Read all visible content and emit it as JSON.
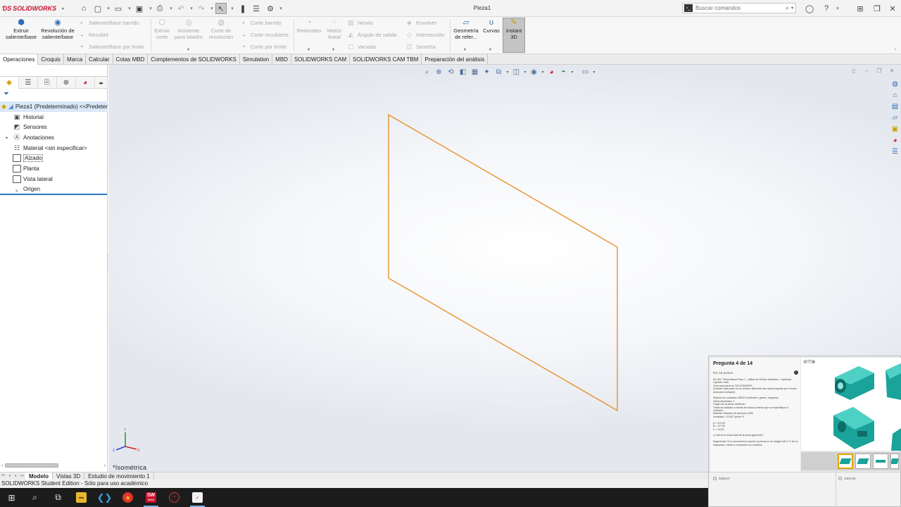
{
  "app": {
    "logo_text": "SOLIDWORKS",
    "document_title": "Pieza1"
  },
  "search": {
    "placeholder": "Buscar comandos"
  },
  "ribbon": {
    "extruir": "Extruir saliente/base",
    "revolucion": "Revolución de saliente/base",
    "barrido": "Saliente/Base barrido",
    "recubrir": "Recubrir",
    "por_limite": "Saliente/Base por límite",
    "extruir_corte": "Extruir corte",
    "asistente": "Asistente para taladro",
    "corte_revolucion": "Corte de revolución",
    "corte_barrido": "Corte barrido",
    "corte_recubierto": "Corte recubierto",
    "corte_limite": "Corte por límite",
    "redondeo": "Redondeo",
    "matriz_lineal": "Matriz lineal",
    "nervio": "Nervio",
    "angulo_salida": "Ángulo de salida",
    "vaciado": "Vaciado",
    "envolver": "Envolver",
    "interseccion": "Intersección",
    "simetria": "Simetría",
    "geometria": "Geometría de refer...",
    "curvas": "Curvas",
    "instant3d": "Instant 3D"
  },
  "tabs": [
    "Operaciones",
    "Croquis",
    "Marca",
    "Calcular",
    "Cotas MBD",
    "Complementos de SOLIDWORKS",
    "Simulation",
    "MBD",
    "SOLIDWORKS CAM",
    "SOLIDWORKS CAM TBM",
    "Preparación del análisis"
  ],
  "tree": {
    "root": "Pieza1 (Predeterminado) <<Predeterminado>",
    "items": [
      "Historial",
      "Sensores",
      "Anotaciones",
      "Material <sin especificar>",
      "Alzado",
      "Planta",
      "Vista lateral",
      "Origen"
    ]
  },
  "viewport": {
    "view_name": "*Isométrica",
    "sketch_color": "#e8922e",
    "triad_labels": {
      "x": "X",
      "y": "Y",
      "z": "Z"
    }
  },
  "bottom_tabs": [
    "Modelo",
    "Vistas 3D",
    "Estudio de movimiento 1"
  ],
  "status": {
    "text": "SOLIDWORKS Student Edition - Sólo para uso académico"
  },
  "quiz": {
    "title": "Pregunta 4 de 14",
    "points": "Por 15 puntos",
    "body": "ID+401: Pieza básica Paso 1 - (Mitad de cilindro hidráulico - Hydraulic Cylinder Half)\nCrea esta pieza en SOLIDWORKS.\n(Guarde cada parte en un archivo diferente tras cada pregunta por si fuera necesario revisarlo)\n\nSistema de unidades: MMGS (milímetro, gramo, segundo)\nCifras decimales: 2\nOrigen de la pieza: Arbitrario\nTodos los taladros a través de todos a menos que se especifique lo contrario.\nMaterial: Aleación de aluminio 1060\nDensidad = 0,0027 g/mm^3\n\nA = 213,00\nB = 117,00\nC = 34,00\n\n¿Cuál es la masa total de la pieza (gramos)?\n\nSugerencia: Si no encuentra la opción correcta en un margen del 1 % de su respuesta, vuelva a comprobar los modelos.",
    "answers": [
      "3205.57",
      "1404.05"
    ],
    "accent": "#1aa39a"
  },
  "taskbar": {
    "sw_badge": "2022"
  }
}
